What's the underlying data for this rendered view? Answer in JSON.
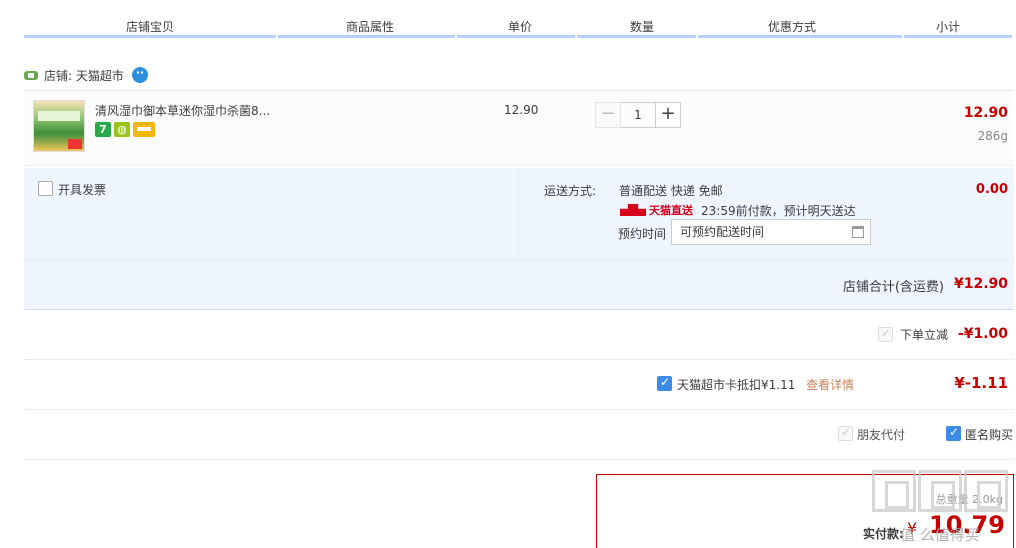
{
  "headers": [
    "店铺宝贝",
    "商品属性",
    "单价",
    "数量",
    "优惠方式",
    "小计"
  ],
  "shop": {
    "label": "店铺: 天猫超市"
  },
  "item": {
    "title": "清风湿巾御本草迷你湿巾杀菌8...",
    "unit_price": "12.90",
    "quantity": "1",
    "qty_minus": "−",
    "qty_plus": "+",
    "subtotal": "12.90",
    "weight": "286g"
  },
  "invoice": {
    "label": "开具发票",
    "checked": false
  },
  "shipping": {
    "label": "运送方式:",
    "method": "普通配送 快递 免邮",
    "tmall_tag": "天猫直送",
    "deadline": "23:59前付款，预计明天送达",
    "appoint_label": "预约时间",
    "appoint_value": "可预约配送时间",
    "fee": "0.00"
  },
  "shop_total": {
    "label": "店铺合计(含运费)",
    "value": "¥12.90"
  },
  "discount": {
    "label": "下单立减",
    "value": "-¥1.00"
  },
  "card": {
    "label": "天猫超市卡抵扣¥1.11",
    "link": "查看详情",
    "value": "¥-1.11",
    "checked": true
  },
  "options": {
    "friend_pay": "朋友代付",
    "anonymous": "匿名购买",
    "anonymous_checked": true
  },
  "payment": {
    "info": "总重量 2.0kg",
    "label": "实付款:",
    "currency": "¥",
    "amount": "10.79"
  },
  "watermark": {
    "text": "值 么值得买"
  },
  "colors": {
    "accent_red": "#c40000",
    "header_blue": "#b2d1ff",
    "check_blue": "#3c8ce7",
    "panel_bg": "#eef5ff"
  }
}
